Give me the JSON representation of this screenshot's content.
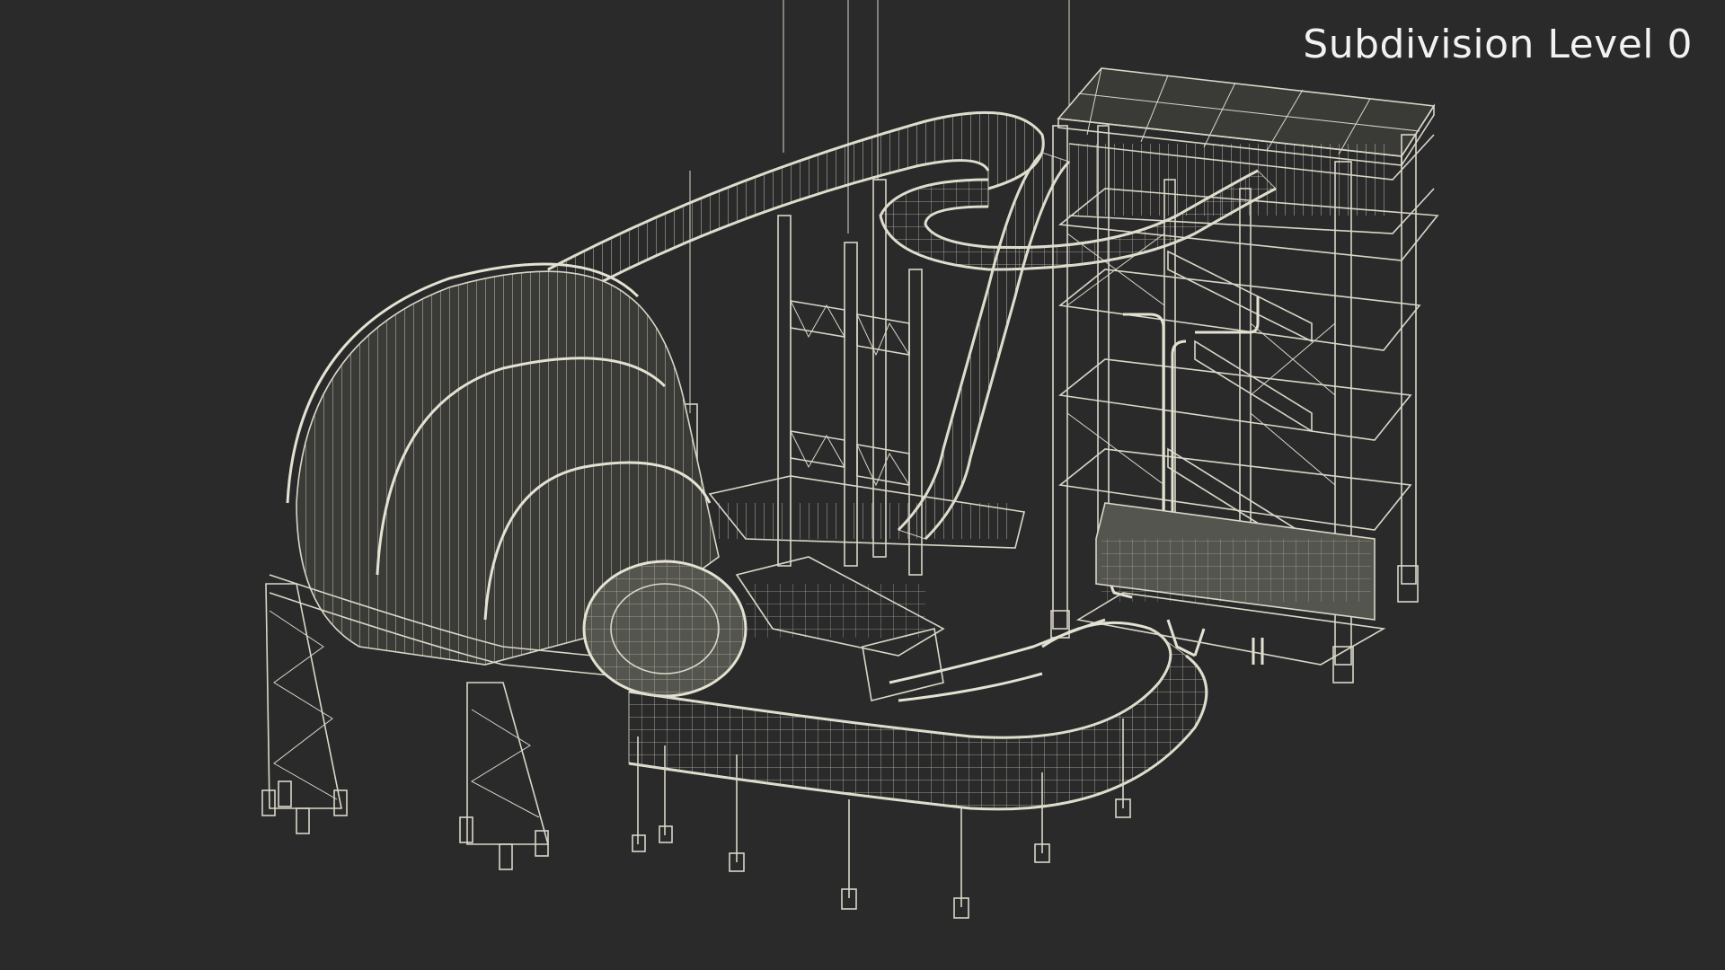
{
  "overlay": {
    "label": "Subdivision Level 0"
  },
  "scene": {
    "subject": "water-slide-tower-wireframe",
    "background_color": "#2a2a2a",
    "wire_color": "#d9d7c8"
  }
}
